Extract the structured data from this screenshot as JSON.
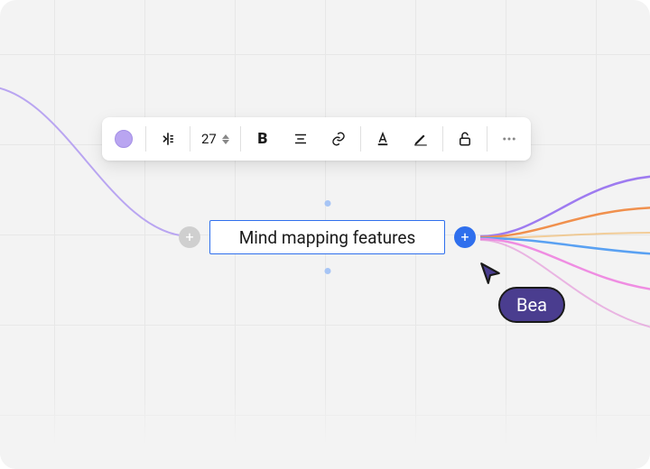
{
  "node": {
    "text": "Mind mapping features"
  },
  "toolbar": {
    "font_size": "27",
    "color_swatch": "#b9a5f1"
  },
  "collaborator": {
    "name": "Bea",
    "color": "#4a3d8f"
  },
  "branches": {
    "left_color": "#b9a5f1",
    "right_colors": [
      "#9e7bf0",
      "#f0904d",
      "#f0ad4e",
      "#5aa1f2",
      "#ef8de2",
      "#e07fd4"
    ]
  },
  "icons": {
    "color": "color-swatch",
    "align_node": "align-node",
    "bold": "bold",
    "text_align": "text-align",
    "link": "link",
    "text_color": "text-color",
    "edit": "edit",
    "lock": "unlock",
    "more": "more"
  }
}
